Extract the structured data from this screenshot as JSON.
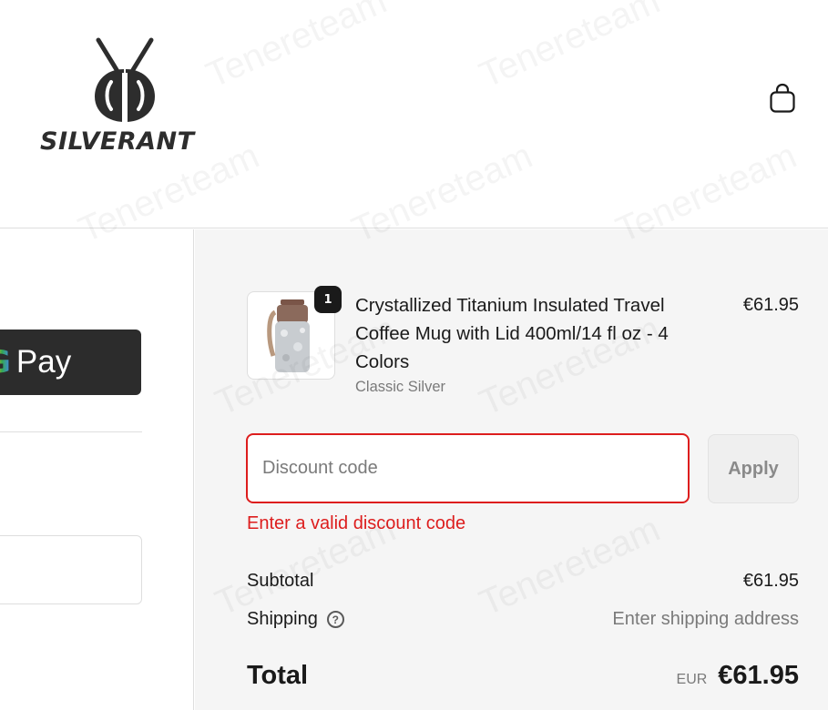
{
  "brand": {
    "name": "SILVERANT"
  },
  "header": {
    "cart_icon": "shopping-bag-icon"
  },
  "express_checkout": {
    "gpay_g": "G",
    "gpay_label": "Pay"
  },
  "order_summary": {
    "item": {
      "quantity": "1",
      "name": "Crystallized Titanium Insulated Travel Coffee Mug with Lid 400ml/14 fl oz - 4 Colors",
      "variant": "Classic Silver",
      "price": "€61.95"
    },
    "discount": {
      "placeholder": "Discount code",
      "value": "",
      "apply_label": "Apply",
      "error": "Enter a valid discount code"
    },
    "subtotal": {
      "label": "Subtotal",
      "value": "€61.95"
    },
    "shipping": {
      "label": "Shipping",
      "value": "Enter shipping address",
      "help_icon": "question-circle-icon"
    },
    "total": {
      "label": "Total",
      "currency": "EUR",
      "value": "€61.95"
    }
  },
  "watermark": "Tenereteam",
  "colors": {
    "error": "#dd1d1d",
    "summary_bg": "#f5f5f5",
    "gpay_bg": "#2c2c2c"
  }
}
